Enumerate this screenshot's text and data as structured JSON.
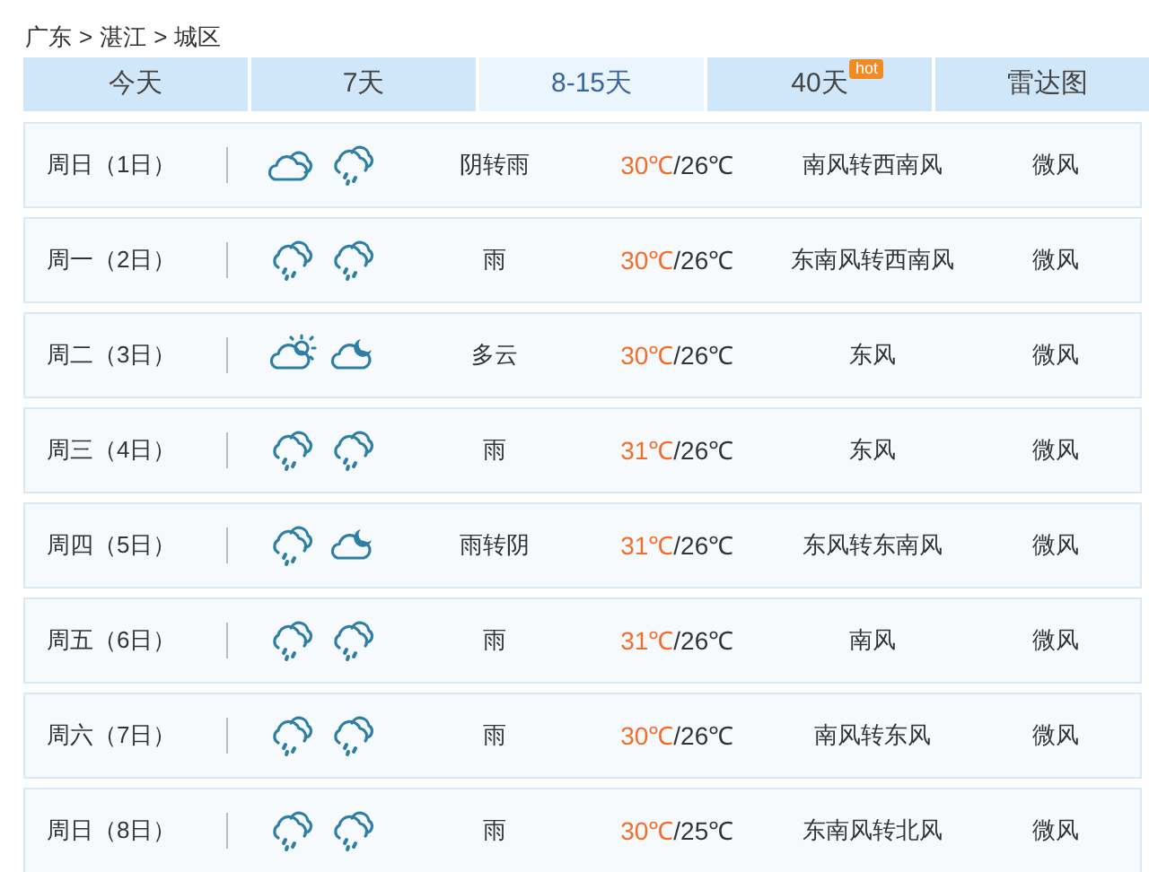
{
  "breadcrumb": [
    "广东",
    "湛江",
    "城区"
  ],
  "breadcrumb_separator": ">",
  "tabs": [
    {
      "label": "今天",
      "selected": false
    },
    {
      "label": "7天",
      "selected": false
    },
    {
      "label": "8-15天",
      "selected": true
    },
    {
      "label": "40天",
      "selected": false,
      "badge": "hot"
    },
    {
      "label": "雷达图",
      "selected": false
    }
  ],
  "days": [
    {
      "date": "周日（1日）",
      "icons": [
        {
          "kind": "cloud"
        },
        {
          "kind": "rain"
        }
      ],
      "weather": "阴转雨",
      "high": "30℃",
      "low": "/26℃",
      "wind": "南风转西南风",
      "wind_level": "微风"
    },
    {
      "date": "周一（2日）",
      "icons": [
        {
          "kind": "rain"
        },
        {
          "kind": "rain"
        }
      ],
      "weather": "雨",
      "high": "30℃",
      "low": "/26℃",
      "wind": "东南风转西南风",
      "wind_level": "微风"
    },
    {
      "date": "周二（3日）",
      "icons": [
        {
          "kind": "sun-cloud"
        },
        {
          "kind": "moon-cloud"
        }
      ],
      "weather": "多云",
      "high": "30℃",
      "low": "/26℃",
      "wind": "东风",
      "wind_level": "微风"
    },
    {
      "date": "周三（4日）",
      "icons": [
        {
          "kind": "rain"
        },
        {
          "kind": "rain"
        }
      ],
      "weather": "雨",
      "high": "31℃",
      "low": "/26℃",
      "wind": "东风",
      "wind_level": "微风"
    },
    {
      "date": "周四（5日）",
      "icons": [
        {
          "kind": "rain"
        },
        {
          "kind": "moon-cloud"
        }
      ],
      "weather": "雨转阴",
      "high": "31℃",
      "low": "/26℃",
      "wind": "东风转东南风",
      "wind_level": "微风"
    },
    {
      "date": "周五（6日）",
      "icons": [
        {
          "kind": "rain"
        },
        {
          "kind": "rain"
        }
      ],
      "weather": "雨",
      "high": "31℃",
      "low": "/26℃",
      "wind": "南风",
      "wind_level": "微风"
    },
    {
      "date": "周六（7日）",
      "icons": [
        {
          "kind": "rain"
        },
        {
          "kind": "rain"
        }
      ],
      "weather": "雨",
      "high": "30℃",
      "low": "/26℃",
      "wind": "南风转东风",
      "wind_level": "微风"
    },
    {
      "date": "周日（8日）",
      "icons": [
        {
          "kind": "rain"
        },
        {
          "kind": "rain"
        }
      ],
      "weather": "雨",
      "high": "30℃",
      "low": "/25℃",
      "wind": "东南风转北风",
      "wind_level": "微风"
    }
  ]
}
